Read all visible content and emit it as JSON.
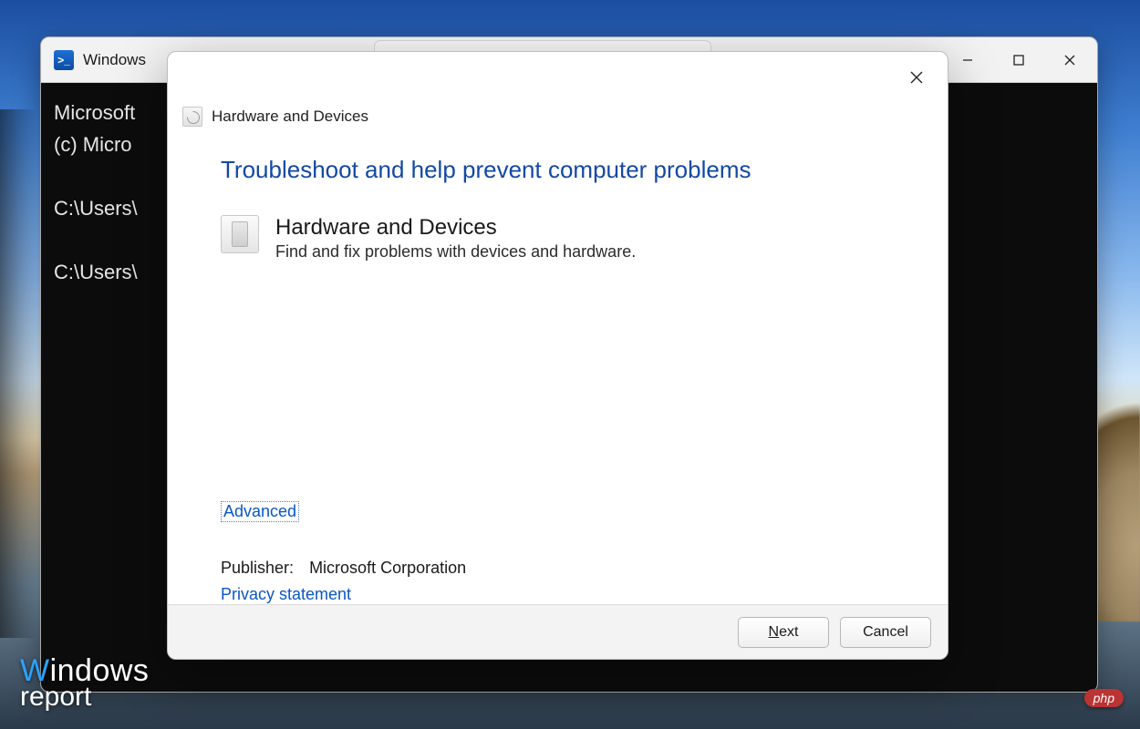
{
  "powershell": {
    "title": "Windows",
    "lines": [
      "Microsoft",
      "(c) Micro",
      "",
      "C:\\Users\\",
      "",
      "C:\\Users\\"
    ],
    "controls": {
      "min": "Minimize",
      "max": "Maximize",
      "close": "Close"
    }
  },
  "wizard": {
    "header_title": "Hardware and Devices",
    "heading": "Troubleshoot and help prevent computer problems",
    "item_title": "Hardware and Devices",
    "item_desc": "Find and fix problems with devices and hardware.",
    "advanced": "Advanced",
    "publisher_label": "Publisher:",
    "publisher_value": "Microsoft Corporation",
    "privacy": "Privacy statement",
    "next": "Next",
    "next_ul": "N",
    "next_rest": "ext",
    "cancel": "Cancel",
    "close": "Close"
  },
  "watermark": {
    "line1a": "W",
    "line1b": "indows",
    "line2": "report"
  },
  "badge": "php"
}
